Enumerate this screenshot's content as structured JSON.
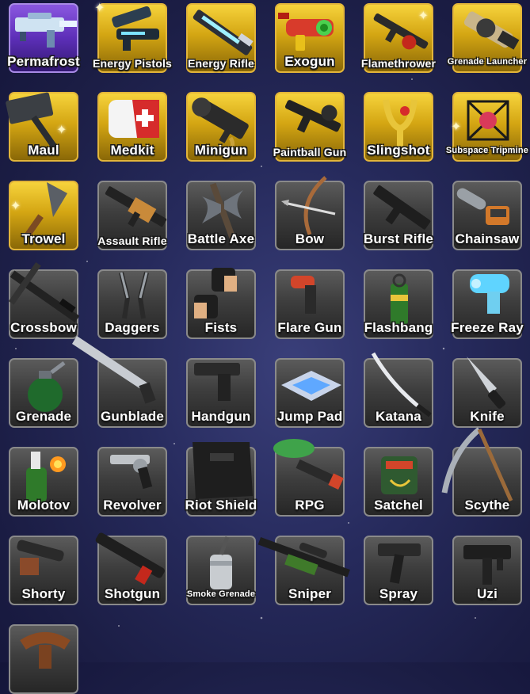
{
  "colors": {
    "gold_tile": "#d4a613",
    "purple_tile": "#5d2fb8",
    "dark_tile": "#3e3e3e",
    "label_text": "#ffffff"
  },
  "items": [
    {
      "label": "Permafrost",
      "rarity": "purple",
      "icon": "permafrost-gun-icon"
    },
    {
      "label": "Energy Pistols",
      "rarity": "gold",
      "icon": "energy-pistols-icon"
    },
    {
      "label": "Energy Rifle",
      "rarity": "gold",
      "icon": "energy-rifle-icon"
    },
    {
      "label": "Exogun",
      "rarity": "gold",
      "icon": "exogun-icon"
    },
    {
      "label": "Flamethrower",
      "rarity": "gold",
      "icon": "flamethrower-icon"
    },
    {
      "label": "Grenade Launcher",
      "rarity": "gold",
      "icon": "grenade-launcher-icon"
    },
    {
      "label": "Maul",
      "rarity": "gold",
      "icon": "maul-icon"
    },
    {
      "label": "Medkit",
      "rarity": "gold",
      "icon": "medkit-icon"
    },
    {
      "label": "Minigun",
      "rarity": "gold",
      "icon": "minigun-icon"
    },
    {
      "label": "Paintball Gun",
      "rarity": "gold",
      "icon": "paintball-gun-icon"
    },
    {
      "label": "Slingshot",
      "rarity": "gold",
      "icon": "slingshot-icon"
    },
    {
      "label": "Subspace Tripmine",
      "rarity": "gold",
      "icon": "subspace-tripmine-icon"
    },
    {
      "label": "Trowel",
      "rarity": "gold",
      "icon": "trowel-icon"
    },
    {
      "label": "Assault Rifle",
      "rarity": "common",
      "icon": "assault-rifle-icon"
    },
    {
      "label": "Battle Axe",
      "rarity": "common",
      "icon": "battle-axe-icon"
    },
    {
      "label": "Bow",
      "rarity": "common",
      "icon": "bow-icon"
    },
    {
      "label": "Burst Rifle",
      "rarity": "common",
      "icon": "burst-rifle-icon"
    },
    {
      "label": "Chainsaw",
      "rarity": "common",
      "icon": "chainsaw-icon"
    },
    {
      "label": "Crossbow",
      "rarity": "common",
      "icon": "crossbow-icon"
    },
    {
      "label": "Daggers",
      "rarity": "common",
      "icon": "daggers-icon"
    },
    {
      "label": "Fists",
      "rarity": "common",
      "icon": "fists-icon"
    },
    {
      "label": "Flare Gun",
      "rarity": "common",
      "icon": "flare-gun-icon"
    },
    {
      "label": "Flashbang",
      "rarity": "common",
      "icon": "flashbang-icon"
    },
    {
      "label": "Freeze Ray",
      "rarity": "common",
      "icon": "freeze-ray-icon"
    },
    {
      "label": "Grenade",
      "rarity": "common",
      "icon": "grenade-icon"
    },
    {
      "label": "Gunblade",
      "rarity": "common",
      "icon": "gunblade-icon"
    },
    {
      "label": "Handgun",
      "rarity": "common",
      "icon": "handgun-icon"
    },
    {
      "label": "Jump Pad",
      "rarity": "common",
      "icon": "jump-pad-icon"
    },
    {
      "label": "Katana",
      "rarity": "common",
      "icon": "katana-icon"
    },
    {
      "label": "Knife",
      "rarity": "common",
      "icon": "knife-icon"
    },
    {
      "label": "Molotov",
      "rarity": "common",
      "icon": "molotov-icon"
    },
    {
      "label": "Revolver",
      "rarity": "common",
      "icon": "revolver-icon"
    },
    {
      "label": "Riot Shield",
      "rarity": "common",
      "icon": "riot-shield-icon"
    },
    {
      "label": "RPG",
      "rarity": "common",
      "icon": "rpg-icon"
    },
    {
      "label": "Satchel",
      "rarity": "common",
      "icon": "satchel-icon"
    },
    {
      "label": "Scythe",
      "rarity": "common",
      "icon": "scythe-icon"
    },
    {
      "label": "Shorty",
      "rarity": "common",
      "icon": "shorty-icon"
    },
    {
      "label": "Shotgun",
      "rarity": "common",
      "icon": "shotgun-icon"
    },
    {
      "label": "Smoke Grenade",
      "rarity": "common",
      "icon": "smoke-grenade-icon"
    },
    {
      "label": "Sniper",
      "rarity": "common",
      "icon": "sniper-icon"
    },
    {
      "label": "Spray",
      "rarity": "common",
      "icon": "spray-icon"
    },
    {
      "label": "Uzi",
      "rarity": "common",
      "icon": "uzi-icon"
    },
    {
      "label": "",
      "rarity": "common",
      "icon": "slingshot-wood-icon"
    }
  ]
}
